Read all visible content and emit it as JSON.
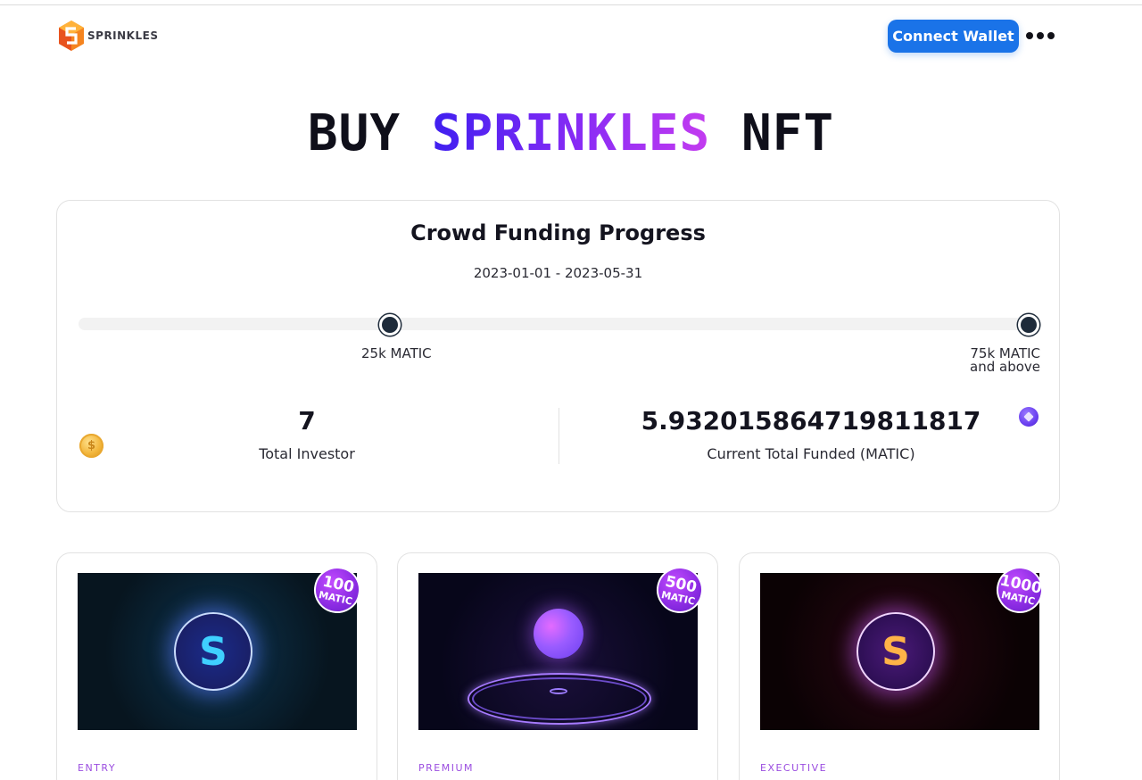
{
  "header": {
    "logo_text": "SPRINKLES",
    "connect_label": "Connect Wallet",
    "more_icon": "ellipsis-icon"
  },
  "hero": {
    "title_prefix": "BUY",
    "title_highlight": "SPRINKLES",
    "title_suffix": "NFT"
  },
  "funding": {
    "title": "Crowd Funding Progress",
    "dates": "2023-01-01 - 2023-05-31",
    "progress_fraction": 0.0,
    "milestones": [
      {
        "label_line1": "25k MATIC",
        "label_line2": ""
      },
      {
        "label_line1": "75k MATIC",
        "label_line2": "and above"
      }
    ],
    "total_investor_value": "7",
    "total_investor_label": "Total Investor",
    "total_funded_value": "5.932015864719811817",
    "total_funded_label": "Current Total Funded (MATIC)"
  },
  "nfts": [
    {
      "price": "100",
      "unit": "MATIC",
      "tier": "ENTRY",
      "emblem": "S"
    },
    {
      "price": "500",
      "unit": "MATIC",
      "tier": "PREMIUM",
      "emblem": ""
    },
    {
      "price": "1000",
      "unit": "MATIC",
      "tier": "EXECUTIVE",
      "emblem": "S"
    }
  ],
  "colors": {
    "accent_blue": "#1a73e8",
    "gradient_start": "#3f1ff0",
    "gradient_end": "#c43cf0",
    "tier_purple": "#9b4de0"
  }
}
